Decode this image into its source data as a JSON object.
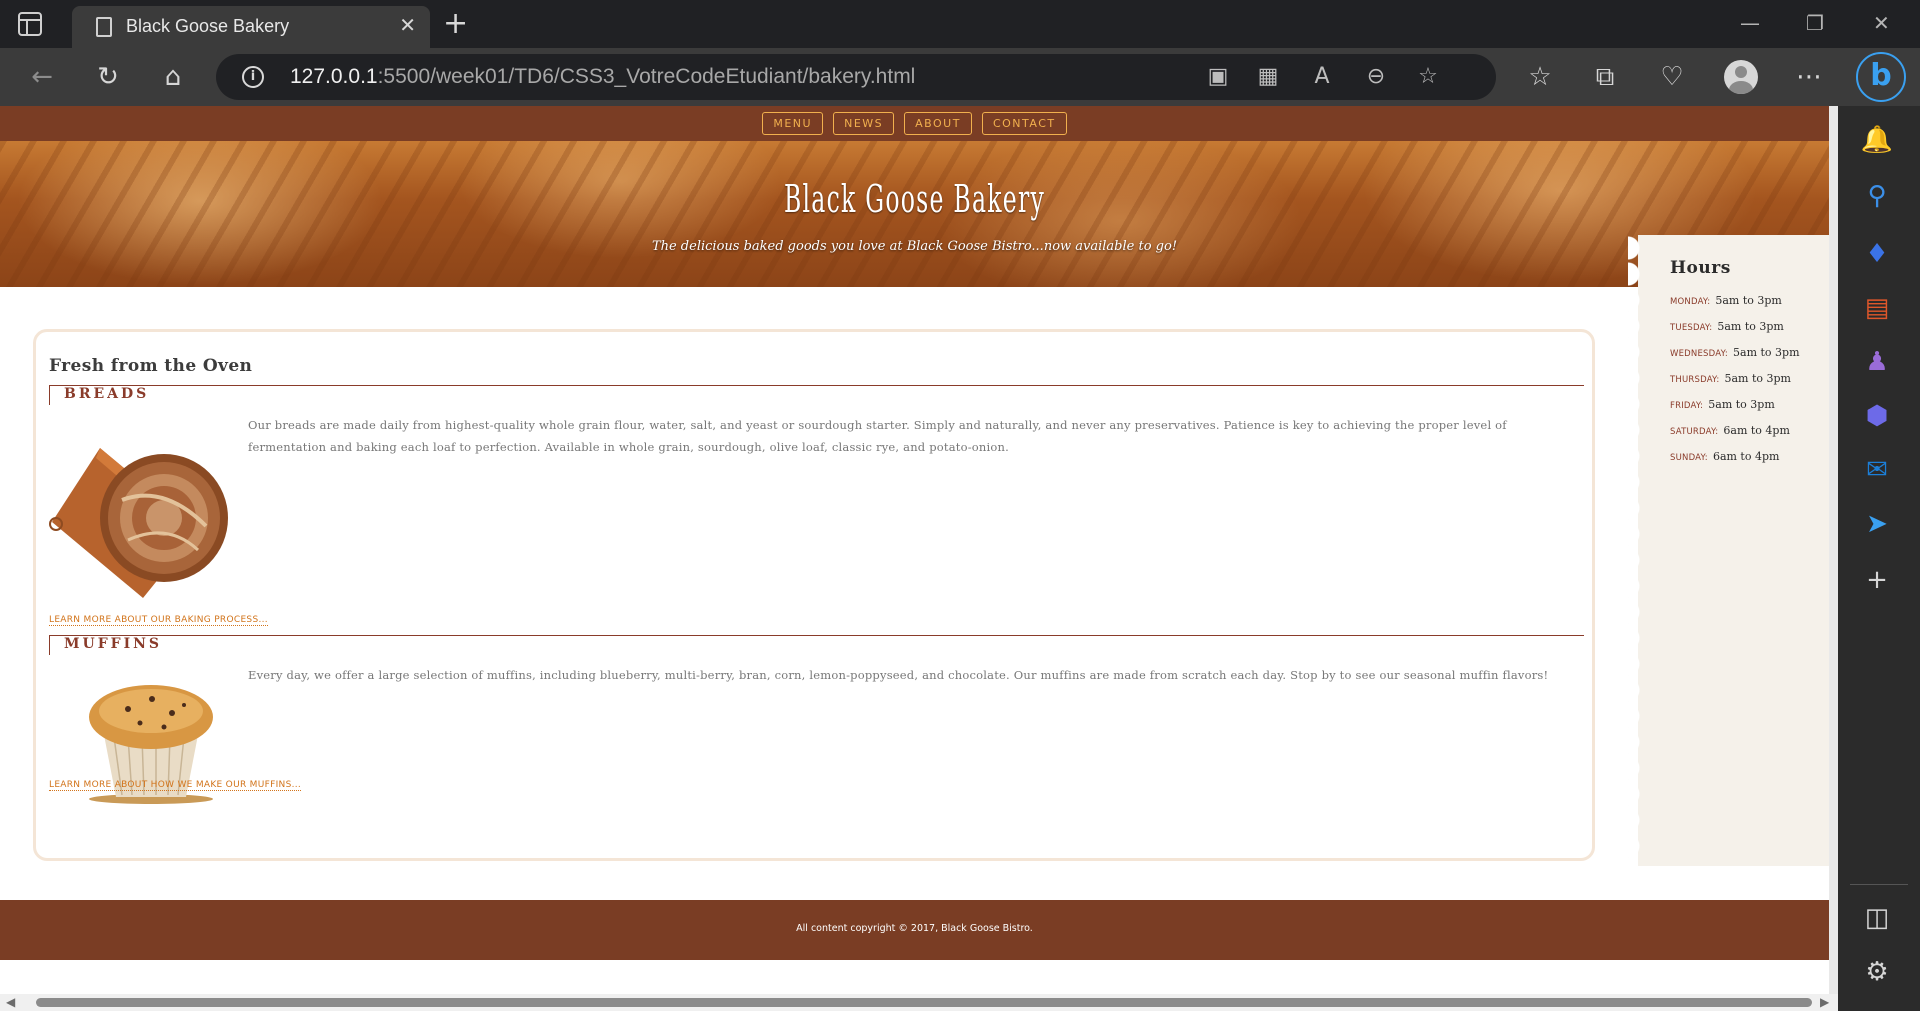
{
  "browser": {
    "tab_title": "Black Goose Bakery",
    "tab_close": "✕",
    "new_tab": "+",
    "url_host": "127.0.0.1",
    "url_rest": ":5500/week01/TD6/CSS3_VotreCodeEtudiant/bakery.html",
    "window_controls": [
      "—",
      "❐",
      "✕"
    ],
    "toolbar_icons": [
      "back-icon",
      "reload-icon",
      "home-icon",
      "info-icon",
      "device-icon",
      "apps-icon",
      "read-aloud-icon",
      "zoom-out-icon",
      "star-icon",
      "favorites-icon",
      "collections-icon",
      "health-icon",
      "profile-icon",
      "more-icon",
      "bing-icon"
    ],
    "accent": "#3aa0f0"
  },
  "sidebar": {
    "icons": [
      "bell-icon",
      "search-icon",
      "tag-icon",
      "toolbox-icon",
      "games-icon",
      "copilot-icon",
      "outlook-icon",
      "send-icon",
      "add-icon",
      "panel-icon",
      "settings-icon"
    ]
  },
  "nav": {
    "items": [
      "Menu",
      "News",
      "About",
      "Contact"
    ]
  },
  "hero": {
    "title": "Black Goose Bakery",
    "tagline": "The delicious baked goods you love at Black Goose Bistro...now available to go!"
  },
  "main": {
    "title": "Fresh from the Oven",
    "breads": {
      "heading": "Breads",
      "text": "Our breads are made daily from highest-quality whole grain flour, water, salt, and yeast or sourdough starter. Simply and naturally, and never any preservatives. Patience is key to achieving the proper level of fermentation and baking each loaf to perfection. Available in whole grain, sourdough, olive loaf, classic rye, and potato-onion.",
      "link": "Learn more about our baking process..."
    },
    "muffins": {
      "heading": "Muffins",
      "text": "Every day, we offer a large selection of muffins, including blueberry, multi-berry, bran, corn, lemon-poppyseed, and chocolate. Our muffins are made from scratch each day. Stop by to see our seasonal muffin flavors!",
      "link": "Learn more about how we make our muffins..."
    }
  },
  "hours": {
    "title": "Hours",
    "rows": [
      {
        "day": "Monday:",
        "time": "5am to 3pm"
      },
      {
        "day": "Tuesday:",
        "time": "5am to 3pm"
      },
      {
        "day": "Wednesday:",
        "time": "5am to 3pm"
      },
      {
        "day": "Thursday:",
        "time": "5am to 3pm"
      },
      {
        "day": "Friday:",
        "time": "5am to 3pm"
      },
      {
        "day": "Saturday:",
        "time": "6am to 4pm"
      },
      {
        "day": "Sunday:",
        "time": "6am to 4pm"
      }
    ]
  },
  "footer": {
    "text": "All content copyright © 2017, Black Goose Bistro."
  },
  "colors": {
    "brown": "#7a3d24",
    "orange": "#f1b04e",
    "heading_red": "#8a3b2a",
    "link_orange": "#d2741b",
    "hours_bg": "#f5f1ea"
  }
}
